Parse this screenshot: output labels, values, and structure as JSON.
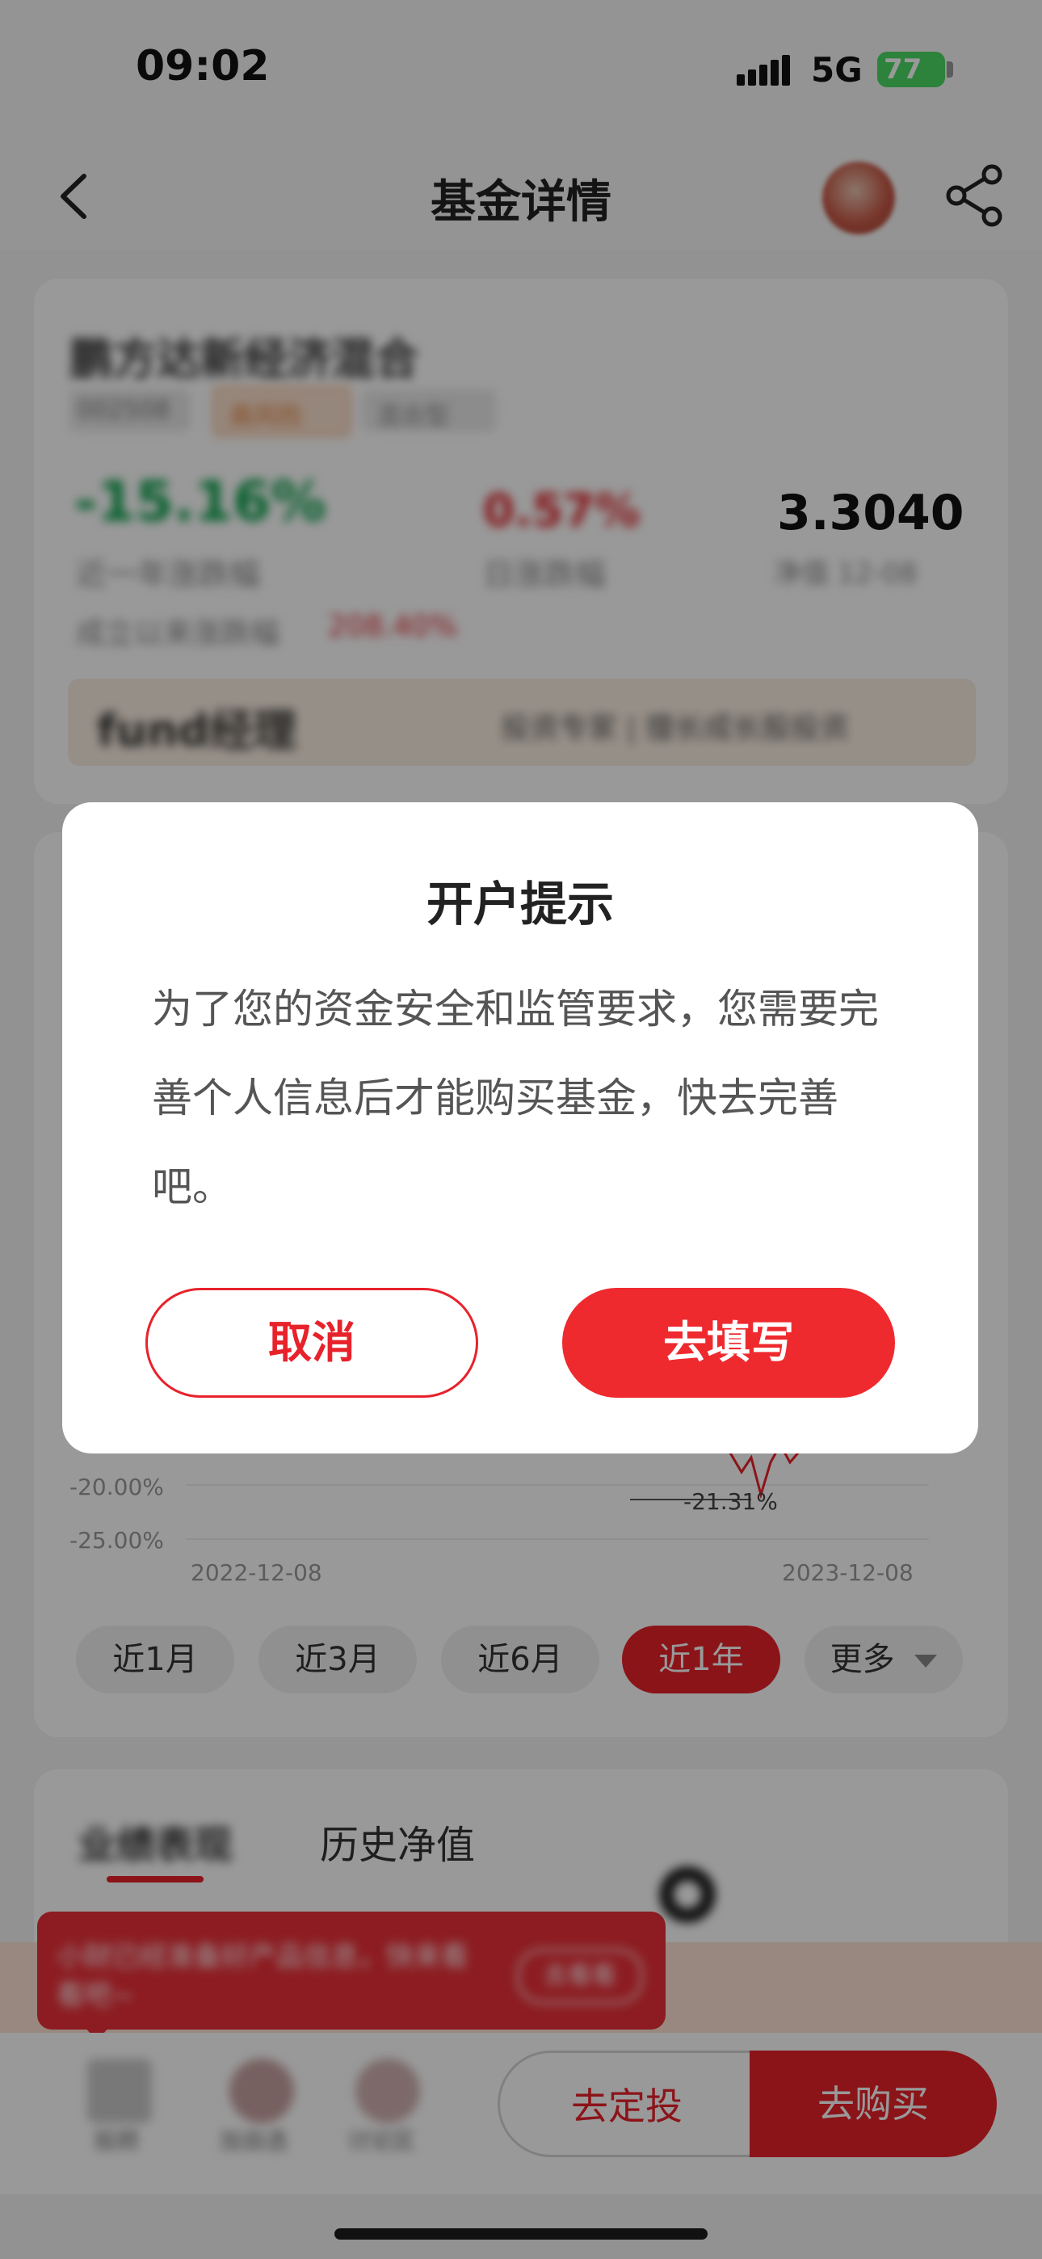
{
  "status_bar": {
    "time": "09:02",
    "network": "5G",
    "battery": "77"
  },
  "nav": {
    "title": "基金详情"
  },
  "fund": {
    "name": "鹏方达新经济混合",
    "tags": [
      "002508",
      "高风险",
      "混合型"
    ],
    "return_1y": "-15.16%",
    "return_1y_label": "近一年涨跌幅",
    "day_change": "0.57%",
    "day_change_label": "日涨跌幅",
    "nav_value": "3.3040",
    "nav_label": "净值 12-08",
    "since_label": "成立以来涨跌幅",
    "since_value": "208.40%",
    "banner_left": "fund经理",
    "banner_right": "投资专家 | 擅长成长股投资"
  },
  "chart": {
    "y_ticks": [
      "-20.00%",
      "-25.00%"
    ],
    "x_ticks": [
      "2022-12-08",
      "2023-12-08"
    ],
    "min_label": "-21.31%",
    "ranges": [
      "近1月",
      "近3月",
      "近6月",
      "近1年",
      "更多"
    ],
    "active_range": "近1年"
  },
  "chart_data": {
    "type": "line",
    "x": [
      "2022-12-08",
      "2023-12-08"
    ],
    "ylabel": "",
    "yticks": [
      "-20.00%",
      "-25.00%"
    ],
    "annotation": "-21.31%",
    "series": [
      {
        "values": []
      }
    ]
  },
  "tabs": {
    "first": "业绩表现",
    "second": "历史净值"
  },
  "promo": {
    "text": "小财已经准备好产品信息，快来看看吧~",
    "button": "去看看"
  },
  "bottom_bar": {
    "icons": [
      {
        "name": "advisor-avatar-icon",
        "label": "投顾"
      },
      {
        "name": "compare-icon",
        "label": "加自选"
      },
      {
        "name": "discuss-icon",
        "label": "讨论区"
      }
    ],
    "sip_button": "去定投",
    "buy_button": "去购买"
  },
  "dialog": {
    "title": "开户提示",
    "body": "为了您的资金安全和监管要求，您需要完善个人信息后才能购买基金，快去完善吧。",
    "cancel": "取消",
    "confirm": "去填写"
  },
  "colors": {
    "accent": "#e8222b",
    "positive": "#e0282e",
    "negative": "#0aa04a"
  }
}
